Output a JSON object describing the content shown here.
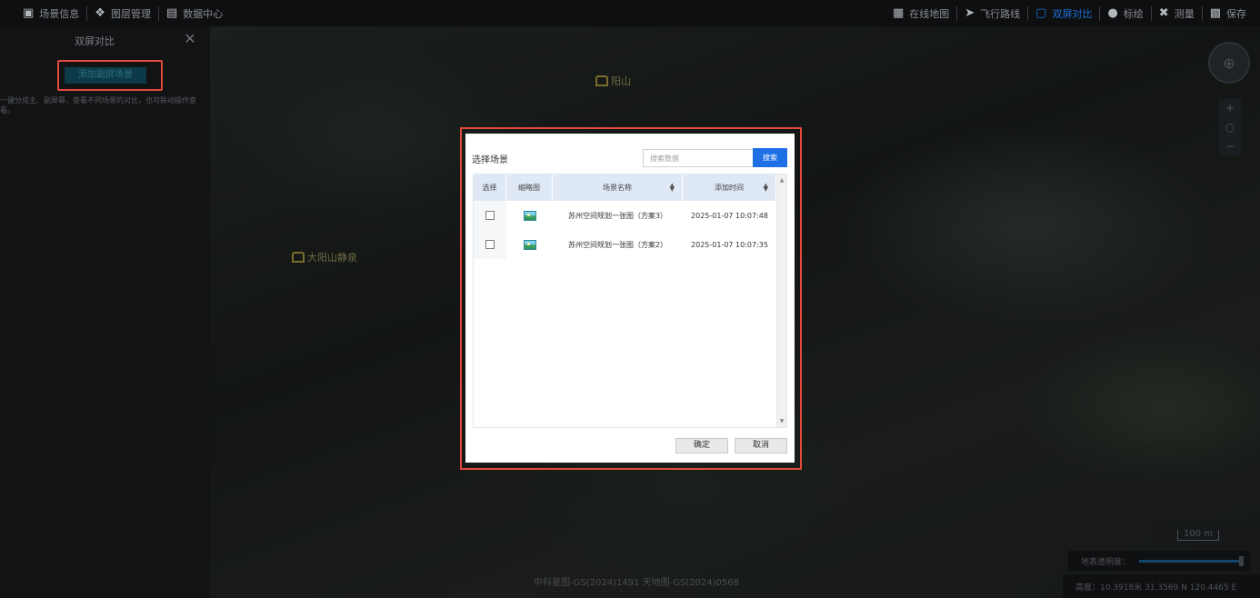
{
  "toolbar": {
    "left": [
      {
        "icon": "scene-info-icon",
        "label": "场景信息"
      },
      {
        "icon": "layer-manage-icon",
        "label": "图层管理"
      },
      {
        "icon": "data-center-icon",
        "label": "数据中心"
      }
    ],
    "right": [
      {
        "icon": "online-map-icon",
        "label": "在线地图"
      },
      {
        "icon": "flight-route-icon",
        "label": "飞行路线"
      },
      {
        "icon": "dual-screen-icon",
        "label": "双屏对比",
        "active": true
      },
      {
        "icon": "annotate-icon",
        "label": "标绘"
      },
      {
        "icon": "measure-icon",
        "label": "测量"
      },
      {
        "icon": "save-icon",
        "label": "保存"
      }
    ]
  },
  "left_panel": {
    "title": "双屏对比",
    "add_button": "添加副屏场景",
    "description": "一键分成主、副屏幕，查看不同场景的对比，也可联动操作查看。"
  },
  "map": {
    "labels": [
      {
        "text": "阳山"
      },
      {
        "text": "大阳山静泉"
      }
    ],
    "scale_text": "100 m",
    "opacity_label": "地表透明度：",
    "opacity_value": 1.0,
    "coords": "高度：10.3918米  31.3569 N  120.4465 E",
    "attribution": "中科星图-GS(2024)1491  天地图-GS(2024)0568"
  },
  "modal": {
    "title": "选择场景",
    "search_placeholder": "搜索数据",
    "search_button": "搜索",
    "columns": [
      "选择",
      "缩略图",
      "场景名称",
      "添加时间"
    ],
    "rows": [
      {
        "name": "苏州空间规划一张图（方案3）",
        "time": "2025-01-07 10:07:48",
        "checked": false
      },
      {
        "name": "苏州空间规划一张图（方案2）",
        "time": "2025-01-07 10:07:35",
        "checked": false
      }
    ],
    "ok_button": "确定",
    "cancel_button": "取消"
  },
  "colors": {
    "accent_blue": "#1f6fe5",
    "highlight_red": "#e24a3b",
    "header_bg": "#dfe9f6"
  }
}
